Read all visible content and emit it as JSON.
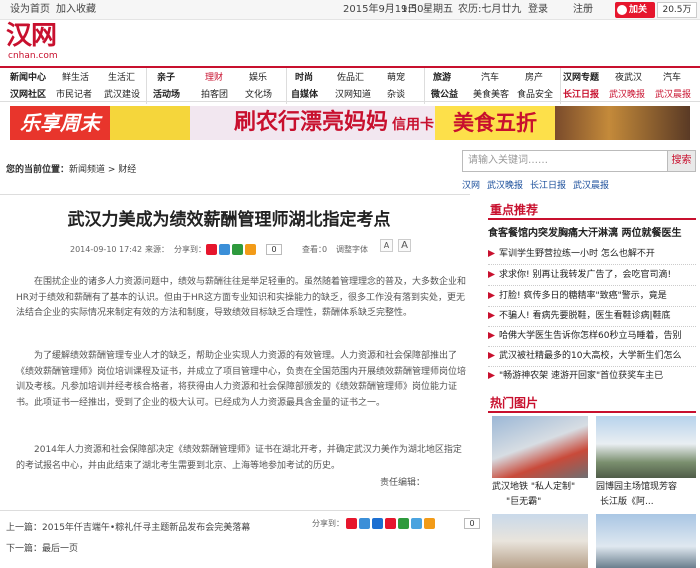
{
  "topbar": {
    "set_homepage": "设为首页",
    "bookmark": "加入收藏",
    "date": "2015年9月11日",
    "time": "9:50",
    "weekday": "星期五",
    "lunar": "农历:七月廿九",
    "login": "登录",
    "register": "注册",
    "follow": "加关注",
    "fans": "20.5万"
  },
  "logo": {
    "name": "汉网",
    "domain": "cnhan.com"
  },
  "nav": {
    "g1": [
      "新闻中心",
      "鲜生活",
      "生活汇",
      "汉网社区",
      "市民记者",
      "武汉建设"
    ],
    "g2": [
      "亲子",
      "理财",
      "娱乐",
      "活动场",
      "拍客团",
      "文化场"
    ],
    "g3": [
      "时尚",
      "佐品汇",
      "萌宠",
      "自媒体",
      "汉网知道",
      "杂谈"
    ],
    "g4": [
      "旅游",
      "汽车",
      "房产",
      "微公益",
      "美食美客",
      "食品安全"
    ],
    "g5": [
      "汉网专题",
      "夜武汉",
      "汽车",
      "长江日报",
      "武汉晚报",
      "武汉晨报"
    ]
  },
  "banner": {
    "left_text": "乐享周末",
    "center_text": "刷农行漂亮妈妈",
    "center_suffix": "信用卡",
    "right_text": "美食五折"
  },
  "breadcrumb": {
    "label": "您的当前位置：",
    "path": [
      "新闻频道",
      "财经"
    ],
    "sep": " > "
  },
  "search": {
    "placeholder": "请输入关键词……",
    "button": "搜索",
    "sites": [
      "汉网",
      "武汉晚报",
      "长江日报",
      "武汉晨报"
    ]
  },
  "article": {
    "title": "武汉力美成为绩效薪酬管理师湖北指定考点",
    "date": "2014-09-10 17:42",
    "source_label": "来源：",
    "share_label": "分享到：",
    "share_count": "0",
    "view_label": "查看：",
    "view_count": "0",
    "font_label": "调整字体",
    "font_small": "A",
    "font_large": "A",
    "paragraphs": [
      "在围扰企业的诸多人力资源问题中，绩效与薪酬往往是举足轻重的。虽然随着管理理念的普及，大多数企业和HR对于绩效和薪酬有了基本的认识。但由于HR这方面专业知识和实操能力的缺乏，很多工作没有落到实处，更无法结合企业的实际情况来制定有效的方法和制度，导致绩效目标缺乏合理性，薪酬体系缺乏完整性。",
      "为了缓解绩效薪酬管理专业人才的缺乏，帮助企业实现人力资源的有效管理。人力资源和社会保障部推出了《绩效薪酬管理师》岗位培训课程及证书，并成立了项目管理中心，负责在全国范围内开展绩效薪酬管理师岗位培训及考核。凡参加培训并经考核合格者，将获得由人力资源和社会保障部颁发的《绩效薪酬管理师》岗位能力证书。此项证书一经推出，受到了企业的极大认可。已经成为人力资源最具含金量的证书之一。",
      "2014年人力资源和社会保障部决定《绩效薪酬管理师》证书在湖北开考，并确定武汉力美作为湖北地区指定的考试报名中心，并由此结束了湖北考生需要到北京、上海等地参加考试的历史。"
    ],
    "editor": "责任编辑：",
    "prev_label": "上一篇：",
    "prev_title": "2015年仟吉端午•粽礼仟寻主题新品发布会完美落幕",
    "next_label": "下一篇：",
    "next_title": "最后一页",
    "bottom_share_label": "分享到：",
    "bottom_share_count": "0"
  },
  "sidebar": {
    "focus_title": "重点推荐",
    "top_news": "食客餐馆内突发胸痛大汗淋漓  两位就餐医生",
    "news": [
      "军训学生野营拉练一小时 怎么也解不开",
      "求求你! 别再让我转发广告了，会吃官司滴!",
      "打脸! 疯传多日的糖精率\"致癌\"警示，竟是",
      "不骗人! 看病先要脱鞋，医生看鞋诊病|鞋底",
      "哈佛大学医生告诉你怎样60秒立马睡着，告别",
      "武汉被社精最多的10大高校，大学新生们怎么",
      "\"畅游神农架 速游开回家\"首位获奖车主已"
    ],
    "photo_title": "热门图片",
    "photos": [
      {
        "caption1": "武汉地铁 \"私人定制\"",
        "caption2": "\"巨无霸\""
      },
      {
        "caption1": "园博园主场馆现芳容",
        "caption2": "长江版《阿..."
      }
    ]
  },
  "colors": {
    "brand_red": "#c8102e",
    "link_blue": "#1a4e9b"
  }
}
